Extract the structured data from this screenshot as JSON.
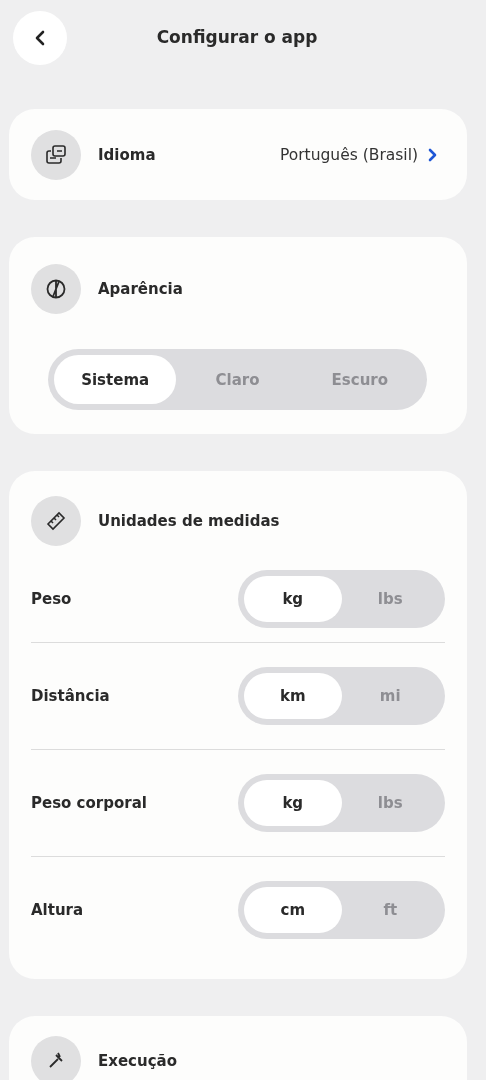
{
  "header": {
    "title": "Configurar o app"
  },
  "language": {
    "label": "Idioma",
    "value": "Português (Brasil)"
  },
  "appearance": {
    "label": "Aparência",
    "options": [
      {
        "label": "Sistema",
        "selected": true
      },
      {
        "label": "Claro",
        "selected": false
      },
      {
        "label": "Escuro",
        "selected": false
      }
    ]
  },
  "units": {
    "label": "Unidades de medidas",
    "rows": [
      {
        "label": "Peso",
        "options": [
          {
            "label": "kg",
            "selected": true
          },
          {
            "label": "lbs",
            "selected": false
          }
        ]
      },
      {
        "label": "Distância",
        "options": [
          {
            "label": "km",
            "selected": true
          },
          {
            "label": "mi",
            "selected": false
          }
        ]
      },
      {
        "label": "Peso corporal",
        "options": [
          {
            "label": "kg",
            "selected": true
          },
          {
            "label": "lbs",
            "selected": false
          }
        ]
      },
      {
        "label": "Altura",
        "options": [
          {
            "label": "cm",
            "selected": true
          },
          {
            "label": "ft",
            "selected": false
          }
        ]
      }
    ]
  },
  "execution": {
    "label": "Execução"
  }
}
